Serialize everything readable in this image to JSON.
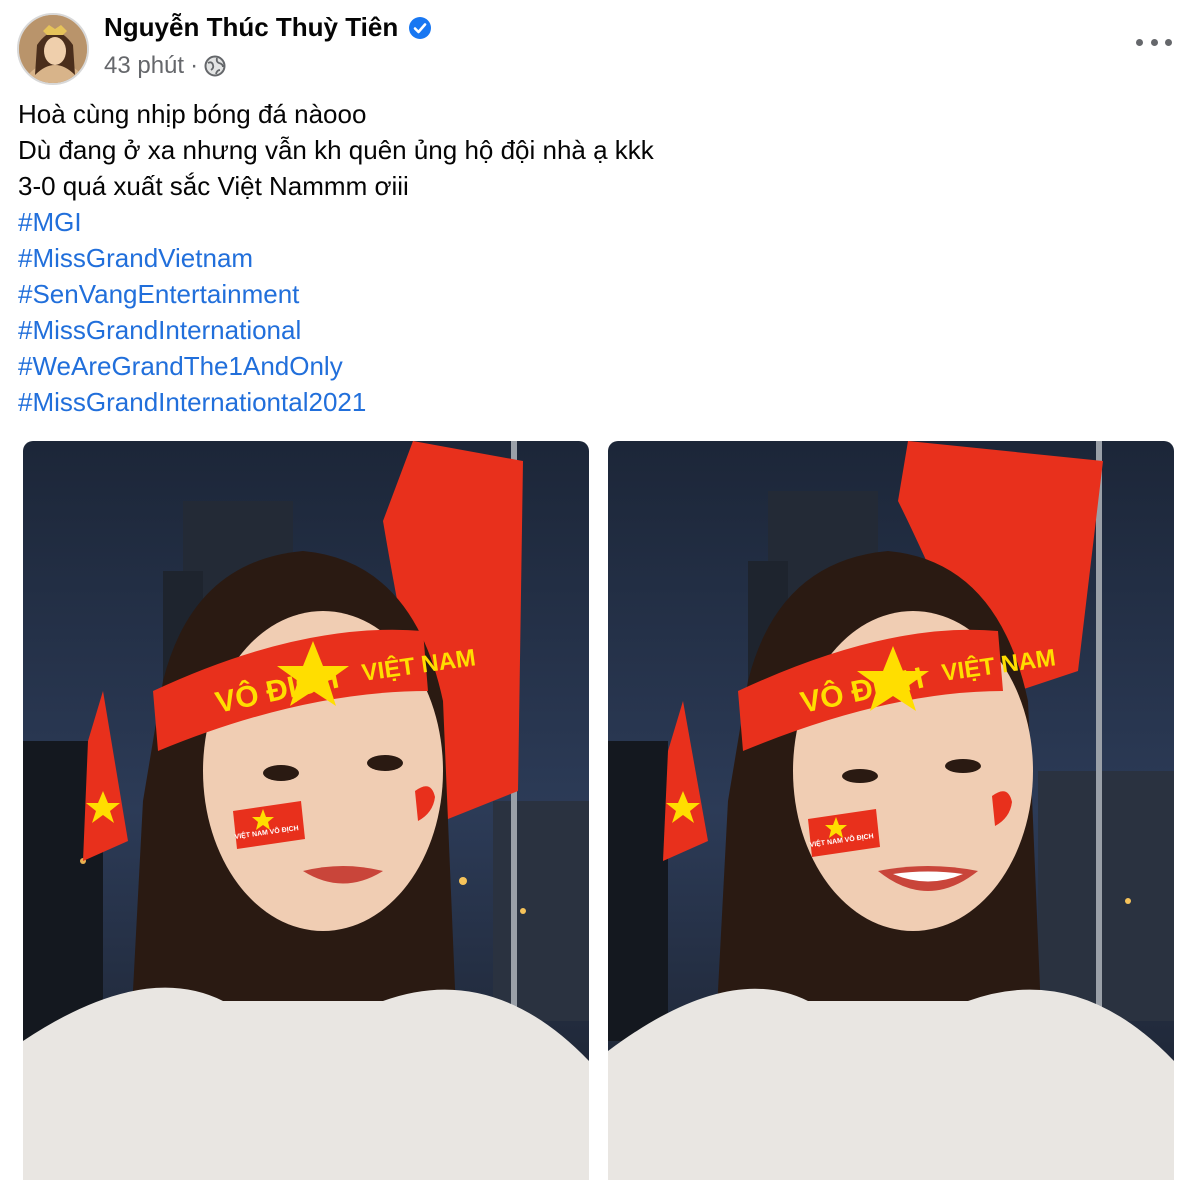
{
  "post": {
    "author_name": "Nguyễn Thúc Thuỳ Tiên",
    "timestamp": "43 phút",
    "separator": "·",
    "privacy_icon": "globe-icon",
    "verified_icon": "verified-badge-icon",
    "more_icon": "more-options-icon",
    "lines": [
      "Hoà cùng nhịp bóng đá nàooo",
      "Dù đang ở xa nhưng vẫn kh quên ủng hộ đội nhà ạ kkk",
      "3-0 quá xuất sắc Việt Nammm ơiii"
    ],
    "hashtags": [
      "#MGI",
      "#MissGrandVietnam",
      "#SenVangEntertainment",
      "#MissGrandInternational",
      "#WeAreGrandThe1AndOnly",
      "#MissGrandInternationtal2021"
    ],
    "photos": [
      {
        "headband_text_left": "VÔ ĐỊCH",
        "headband_text_right": "VIỆT NAM",
        "cheek_sticker_text": "VIỆT NAM VÔ ĐỊCH"
      },
      {
        "headband_text_left": "VÔ ĐỊCH",
        "headband_text_right": "VIỆT NAM",
        "cheek_sticker_text": "VIỆT NAM VÔ ĐỊCH"
      }
    ]
  },
  "colors": {
    "link": "#216fdb",
    "secondary_text": "#65676b",
    "verified": "#1877f2",
    "flag_red": "#e8301c",
    "flag_star": "#ffde00"
  }
}
